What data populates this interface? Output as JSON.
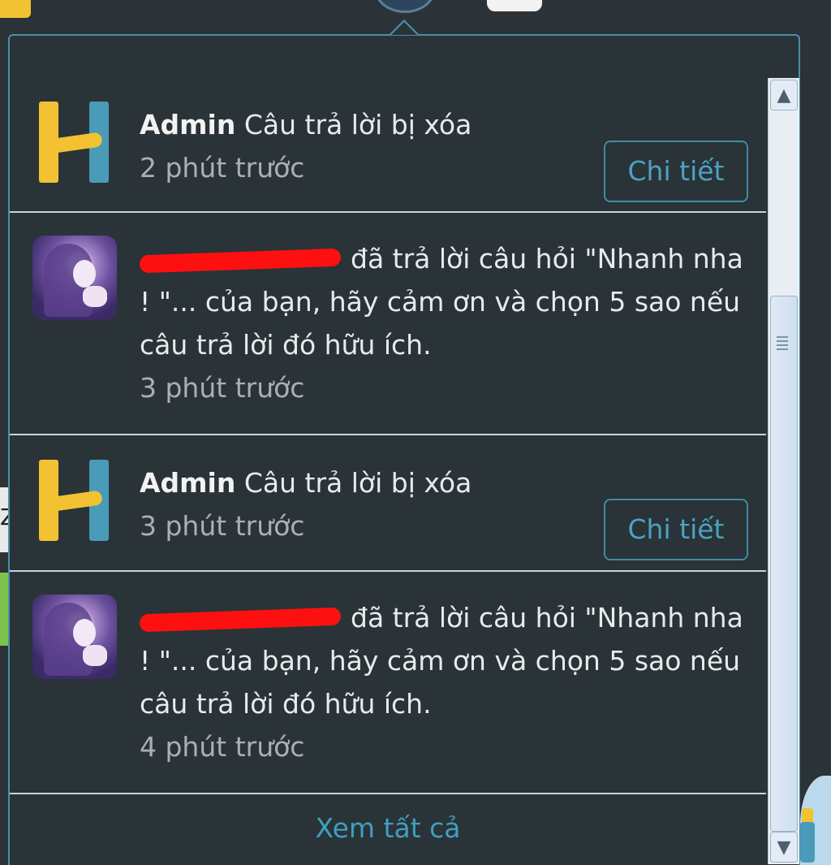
{
  "notifications": {
    "items": [
      {
        "type": "admin",
        "author": "Admin",
        "message": "Câu trả lời bị xóa",
        "time": "2 phút trước",
        "button_label": "Chi tiết"
      },
      {
        "type": "reply",
        "message": "đã trả lời câu hỏi \"Nhanh nha ! \"... của bạn, hãy cảm ơn và chọn 5 sao nếu câu trả lời đó hữu ích.",
        "time": "3 phút trước"
      },
      {
        "type": "admin",
        "author": "Admin",
        "message": "Câu trả lời bị xóa",
        "time": "3 phút trước",
        "button_label": "Chi tiết"
      },
      {
        "type": "reply",
        "message": "đã trả lời câu hỏi \"Nhanh nha ! \"... của bạn, hãy cảm ơn và chọn 5 sao nếu câu trả lời đó hữu ích.",
        "time": "4 phút trước"
      }
    ],
    "see_all_label": "Xem tất cả"
  },
  "colors": {
    "panel_bg": "#2a3337",
    "accent": "#4aa3c3",
    "logo_yellow": "#f2c232",
    "logo_teal": "#4a9bb8",
    "redaction": "#ff1010"
  },
  "icons": [
    "h-logo-icon",
    "user-avatar-icon",
    "scroll-up-icon",
    "scroll-down-icon",
    "scroll-grip-icon"
  ]
}
